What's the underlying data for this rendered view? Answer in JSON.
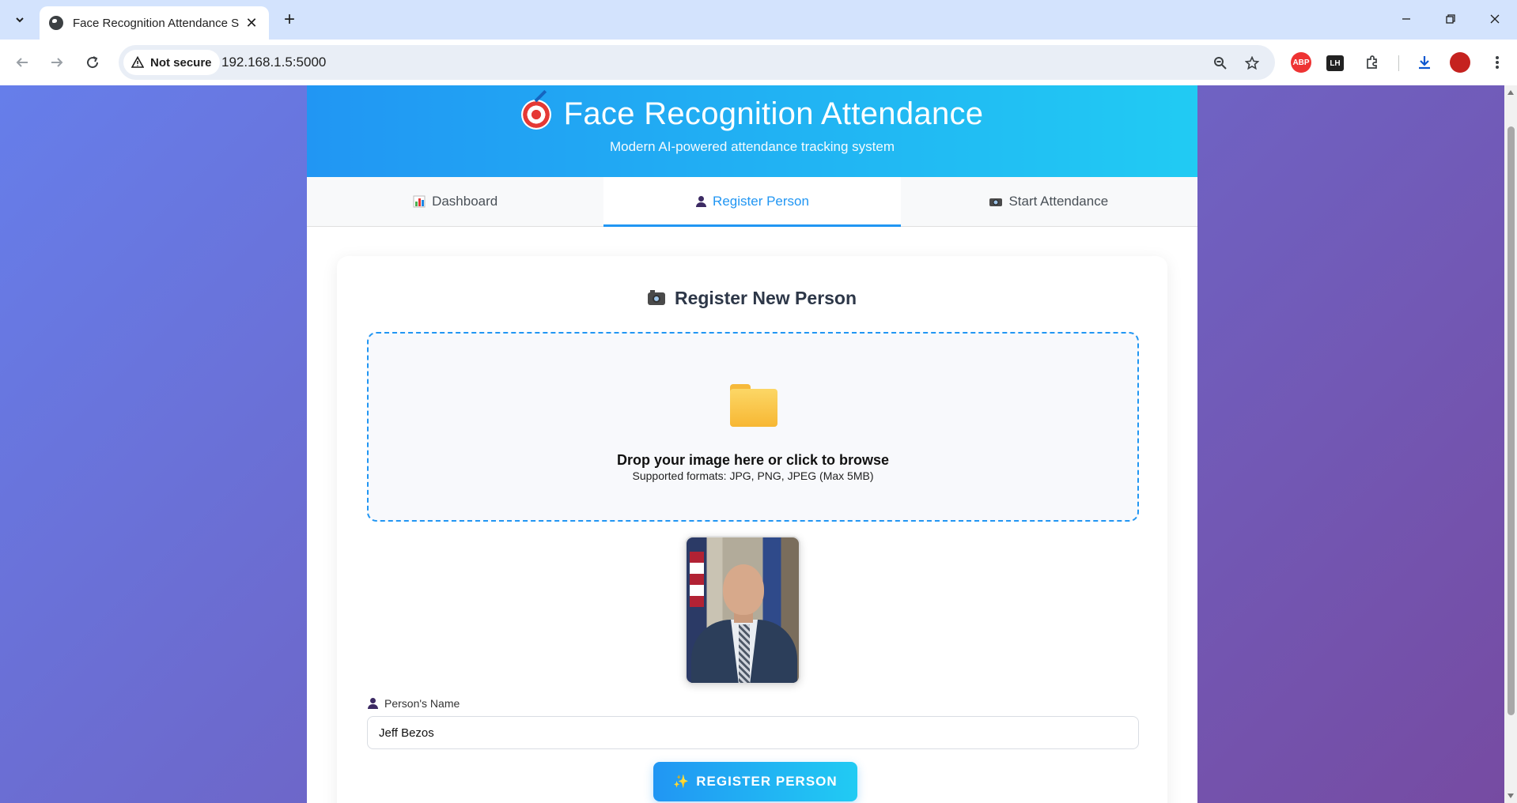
{
  "browser": {
    "tab_title": "Face Recognition Attendance Sy",
    "security_label": "Not secure",
    "url": "192.168.1.5:5000",
    "extensions": {
      "abp": "ABP",
      "lh": "LH"
    }
  },
  "header": {
    "title": "Face Recognition Attendance",
    "subtitle": "Modern AI-powered attendance tracking system",
    "icon": "target-icon"
  },
  "tabs": [
    {
      "label": "Dashboard",
      "icon": "bar-chart-icon",
      "active": false
    },
    {
      "label": "Register Person",
      "icon": "person-icon",
      "active": true
    },
    {
      "label": "Start Attendance",
      "icon": "camera-icon",
      "active": false
    }
  ],
  "register": {
    "title": "Register New Person",
    "title_icon": "camera-icon",
    "dropzone": {
      "icon": "folder-icon",
      "text": "Drop your image here or click to browse",
      "subtext": "Supported formats: JPG, PNG, JPEG (Max 5MB)"
    },
    "name_label": "Person's Name",
    "name_value": "Jeff Bezos",
    "button_label": "REGISTER PERSON",
    "button_icon": "sparkle-icon"
  },
  "colors": {
    "accent": "#2196f3",
    "accent_light": "#21cbf3",
    "background_start": "#667eea",
    "background_end": "#764ba2"
  }
}
